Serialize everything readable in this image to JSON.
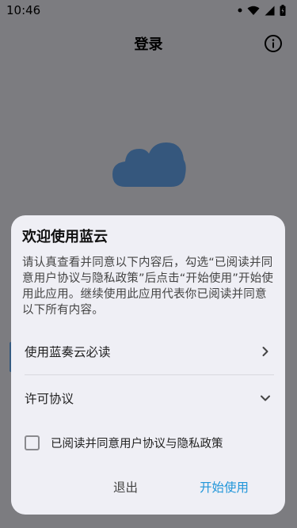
{
  "status_bar": {
    "time": "10:46"
  },
  "app_bar": {
    "title": "登录",
    "info_icon": "info-icon"
  },
  "logo": {
    "icon": "cloud-logo-icon",
    "color": "#3a6ea8"
  },
  "dialog": {
    "title": "欢迎使用蓝云",
    "body": "请认真查看并同意以下内容后，勾选“已阅读并同意用户协议与隐私政策”后点击“开始使用”开始使用此应用。继续使用此应用代表你已阅读并同意以下所有内容。",
    "rows": [
      {
        "label": "使用蓝奏云必读",
        "icon": "chevron-right-icon"
      },
      {
        "label": "许可协议",
        "icon": "chevron-down-icon"
      }
    ],
    "checkbox_label": "已阅读并同意用户协议与隐私政策",
    "checked": false,
    "exit_label": "退出",
    "start_label": "开始使用",
    "accent_color": "#2196d9"
  }
}
